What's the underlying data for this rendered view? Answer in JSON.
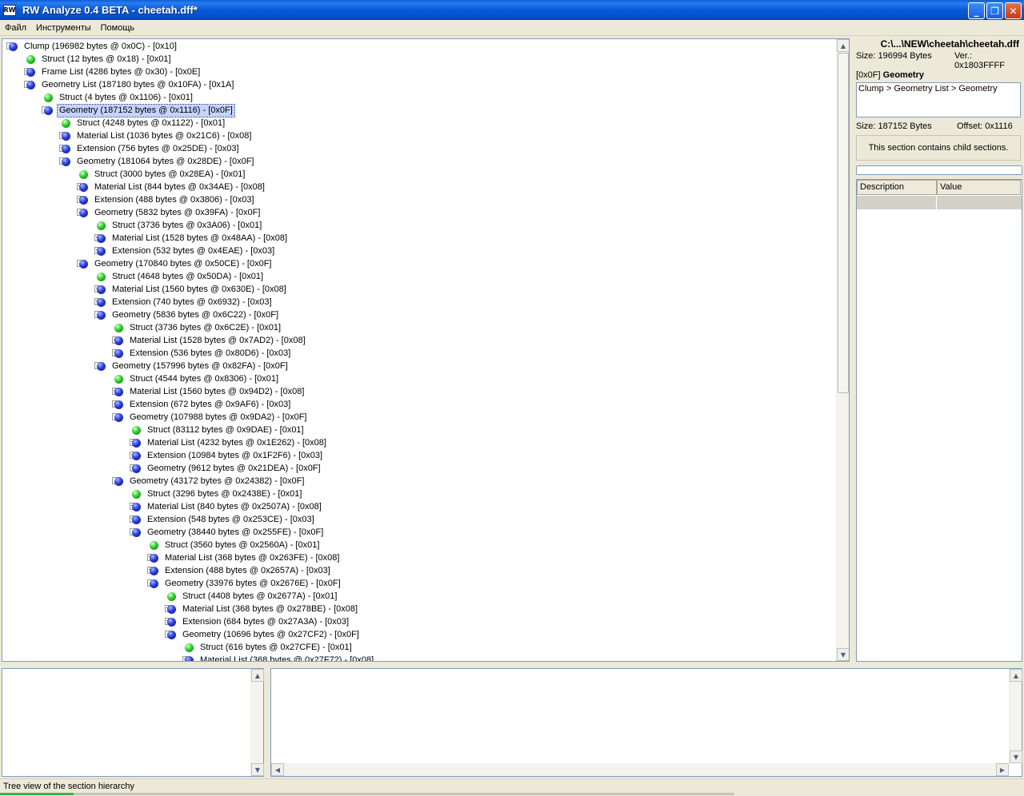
{
  "window": {
    "title": "RW Analyze 0.4 BETA - cheetah.dff*",
    "app_icon": "RW"
  },
  "menu": [
    "Файл",
    "Инструменты",
    "Помощь"
  ],
  "tree": [
    {
      "label": "Clump  (196982 bytes @ 0x0C) - [0x10]",
      "depth": 0,
      "type": "blue",
      "exp": "-"
    },
    {
      "label": "Struct  (12 bytes @ 0x18) - [0x01]",
      "depth": 1,
      "type": "green",
      "exp": ""
    },
    {
      "label": "Frame List  (4286 bytes @ 0x30) - [0x0E]",
      "depth": 1,
      "type": "blue",
      "exp": "+"
    },
    {
      "label": "Geometry List  (187180 bytes @ 0x10FA) - [0x1A]",
      "depth": 1,
      "type": "blue",
      "exp": "-"
    },
    {
      "label": "Struct  (4 bytes @ 0x1106) - [0x01]",
      "depth": 2,
      "type": "green",
      "exp": ""
    },
    {
      "label": "Geometry  (187152 bytes @ 0x1116) - [0x0F]",
      "depth": 2,
      "type": "blue",
      "exp": "-",
      "selected": true
    },
    {
      "label": "Struct  (4248 bytes @ 0x1122) - [0x01]",
      "depth": 3,
      "type": "green",
      "exp": ""
    },
    {
      "label": "Material List  (1036 bytes @ 0x21C6) - [0x08]",
      "depth": 3,
      "type": "blue",
      "exp": "+"
    },
    {
      "label": "Extension  (756 bytes @ 0x25DE) - [0x03]",
      "depth": 3,
      "type": "blue",
      "exp": "+"
    },
    {
      "label": "Geometry  (181064 bytes @ 0x28DE) - [0x0F]",
      "depth": 3,
      "type": "blue",
      "exp": "-"
    },
    {
      "label": "Struct  (3000 bytes @ 0x28EA) - [0x01]",
      "depth": 4,
      "type": "green",
      "exp": ""
    },
    {
      "label": "Material List  (844 bytes @ 0x34AE) - [0x08]",
      "depth": 4,
      "type": "blue",
      "exp": "+"
    },
    {
      "label": "Extension  (488 bytes @ 0x3806) - [0x03]",
      "depth": 4,
      "type": "blue",
      "exp": "+"
    },
    {
      "label": "Geometry  (5832 bytes @ 0x39FA) - [0x0F]",
      "depth": 4,
      "type": "blue",
      "exp": "-"
    },
    {
      "label": "Struct  (3736 bytes @ 0x3A06) - [0x01]",
      "depth": 5,
      "type": "green",
      "exp": ""
    },
    {
      "label": "Material List  (1528 bytes @ 0x48AA) - [0x08]",
      "depth": 5,
      "type": "blue",
      "exp": "+"
    },
    {
      "label": "Extension  (532 bytes @ 0x4EAE) - [0x03]",
      "depth": 5,
      "type": "blue",
      "exp": "+"
    },
    {
      "label": "Geometry  (170840 bytes @ 0x50CE) - [0x0F]",
      "depth": 4,
      "type": "blue",
      "exp": "-"
    },
    {
      "label": "Struct  (4648 bytes @ 0x50DA) - [0x01]",
      "depth": 5,
      "type": "green",
      "exp": ""
    },
    {
      "label": "Material List  (1560 bytes @ 0x630E) - [0x08]",
      "depth": 5,
      "type": "blue",
      "exp": "+"
    },
    {
      "label": "Extension  (740 bytes @ 0x6932) - [0x03]",
      "depth": 5,
      "type": "blue",
      "exp": "+"
    },
    {
      "label": "Geometry  (5836 bytes @ 0x6C22) - [0x0F]",
      "depth": 5,
      "type": "blue",
      "exp": "-"
    },
    {
      "label": "Struct  (3736 bytes @ 0x6C2E) - [0x01]",
      "depth": 6,
      "type": "green",
      "exp": ""
    },
    {
      "label": "Material List  (1528 bytes @ 0x7AD2) - [0x08]",
      "depth": 6,
      "type": "blue",
      "exp": "+"
    },
    {
      "label": "Extension  (536 bytes @ 0x80D6) - [0x03]",
      "depth": 6,
      "type": "blue",
      "exp": "+"
    },
    {
      "label": "Geometry  (157996 bytes @ 0x82FA) - [0x0F]",
      "depth": 5,
      "type": "blue",
      "exp": "-"
    },
    {
      "label": "Struct  (4544 bytes @ 0x8306) - [0x01]",
      "depth": 6,
      "type": "green",
      "exp": ""
    },
    {
      "label": "Material List  (1560 bytes @ 0x94D2) - [0x08]",
      "depth": 6,
      "type": "blue",
      "exp": "+"
    },
    {
      "label": "Extension  (672 bytes @ 0x9AF6) - [0x03]",
      "depth": 6,
      "type": "blue",
      "exp": "+"
    },
    {
      "label": "Geometry  (107988 bytes @ 0x9DA2) - [0x0F]",
      "depth": 6,
      "type": "blue",
      "exp": "-"
    },
    {
      "label": "Struct  (83112 bytes @ 0x9DAE) - [0x01]",
      "depth": 7,
      "type": "green",
      "exp": ""
    },
    {
      "label": "Material List  (4232 bytes @ 0x1E262) - [0x08]",
      "depth": 7,
      "type": "blue",
      "exp": "+"
    },
    {
      "label": "Extension  (10984 bytes @ 0x1F2F6) - [0x03]",
      "depth": 7,
      "type": "blue",
      "exp": "+"
    },
    {
      "label": "Geometry  (9612 bytes @ 0x21DEA) - [0x0F]",
      "depth": 7,
      "type": "blue",
      "exp": "+"
    },
    {
      "label": "Geometry  (43172 bytes @ 0x24382) - [0x0F]",
      "depth": 6,
      "type": "blue",
      "exp": "-"
    },
    {
      "label": "Struct  (3296 bytes @ 0x2438E) - [0x01]",
      "depth": 7,
      "type": "green",
      "exp": ""
    },
    {
      "label": "Material List  (840 bytes @ 0x2507A) - [0x08]",
      "depth": 7,
      "type": "blue",
      "exp": "+"
    },
    {
      "label": "Extension  (548 bytes @ 0x253CE) - [0x03]",
      "depth": 7,
      "type": "blue",
      "exp": "+"
    },
    {
      "label": "Geometry  (38440 bytes @ 0x255FE) - [0x0F]",
      "depth": 7,
      "type": "blue",
      "exp": "-"
    },
    {
      "label": "Struct  (3560 bytes @ 0x2560A) - [0x01]",
      "depth": 8,
      "type": "green",
      "exp": ""
    },
    {
      "label": "Material List  (368 bytes @ 0x263FE) - [0x08]",
      "depth": 8,
      "type": "blue",
      "exp": "+"
    },
    {
      "label": "Extension  (488 bytes @ 0x2657A) - [0x03]",
      "depth": 8,
      "type": "blue",
      "exp": "+"
    },
    {
      "label": "Geometry  (33976 bytes @ 0x2676E) - [0x0F]",
      "depth": 8,
      "type": "blue",
      "exp": "-"
    },
    {
      "label": "Struct  (4408 bytes @ 0x2677A) - [0x01]",
      "depth": 9,
      "type": "green",
      "exp": ""
    },
    {
      "label": "Material List  (368 bytes @ 0x278BE) - [0x08]",
      "depth": 9,
      "type": "blue",
      "exp": "+"
    },
    {
      "label": "Extension  (684 bytes @ 0x27A3A) - [0x03]",
      "depth": 9,
      "type": "blue",
      "exp": "+"
    },
    {
      "label": "Geometry  (10696 bytes @ 0x27CF2) - [0x0F]",
      "depth": 9,
      "type": "blue",
      "exp": "-"
    },
    {
      "label": "Struct  (616 bytes @ 0x27CFE) - [0x01]",
      "depth": 10,
      "type": "green",
      "exp": ""
    },
    {
      "label": "Material List  (368 bytes @ 0x27F72) - [0x08]",
      "depth": 10,
      "type": "blue",
      "exp": "+"
    }
  ],
  "details": {
    "path": "C:\\...\\NEW\\cheetah\\cheetah.dff",
    "file_size": "Size: 196994 Bytes",
    "version": "Ver.: 0x1803FFFF",
    "section_id": "[0x0F]",
    "section_name": "Geometry",
    "breadcrumb": "Clump > Geometry List > Geometry",
    "section_size": "Size: 187152 Bytes",
    "section_offset": "Offset: 0x1116",
    "info": "This section contains child sections.",
    "grid_headers": [
      "Description",
      "Value"
    ]
  },
  "status": {
    "text": "Tree view of the section hierarchy",
    "progress": 0.1
  },
  "colors": {
    "orb_blue": "#2a3cd8",
    "orb_green": "#2ed02a",
    "selection": "#c6d3ff"
  }
}
